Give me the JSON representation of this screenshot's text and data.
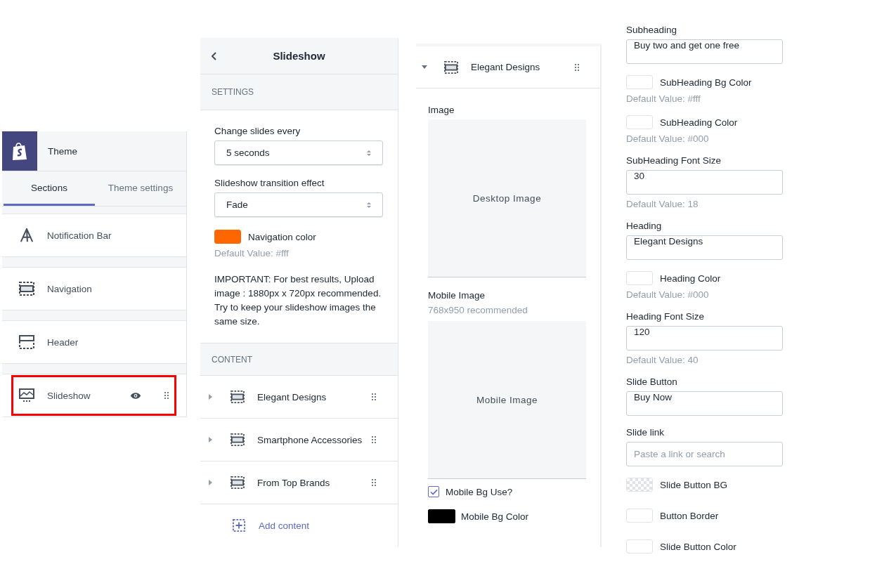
{
  "theme_panel": {
    "title": "Theme",
    "tabs": [
      {
        "label": "Sections",
        "selected": true
      },
      {
        "label": "Theme settings",
        "selected": false
      }
    ],
    "sections": [
      {
        "kind": "text",
        "label": "Notification Bar",
        "highlighted": false
      },
      {
        "kind": "navigation",
        "label": "Navigation",
        "highlighted": false
      },
      {
        "kind": "header",
        "label": "Header",
        "highlighted": false
      },
      {
        "kind": "slideshow",
        "label": "Slideshow",
        "highlighted": true
      }
    ]
  },
  "slideshow_panel": {
    "title": "Slideshow",
    "settings_heading": "SETTINGS",
    "settings": [
      {
        "kind": "select",
        "label": "Change slides every",
        "value": "5 seconds"
      },
      {
        "kind": "select",
        "label": "Slideshow transition effect",
        "value": "Fade"
      },
      {
        "kind": "color",
        "label": "Navigation color",
        "color": "#ff6600",
        "hint": "Default Value: #fff"
      },
      {
        "kind": "note",
        "text": "IMPORTANT: For best results, Upload image : 1880px x 720px recommended. Try to keep your slideshow images the same size."
      }
    ],
    "content_heading": "CONTENT",
    "blocks": [
      {
        "label": "Elegant Designs"
      },
      {
        "label": "Smartphone Accessories"
      },
      {
        "label": "From Top Brands"
      }
    ],
    "add_label": "Add content"
  },
  "block_panel": {
    "title": "Elegant Designs",
    "expanded": true,
    "fields": [
      {
        "kind": "image",
        "label": "Image",
        "placeholder": "Desktop Image"
      },
      {
        "kind": "image",
        "label": "Mobile Image",
        "hint": "768x950 recommended",
        "placeholder": "Mobile Image"
      },
      {
        "kind": "checkbox",
        "label": "Mobile Bg Use?",
        "checked": true
      },
      {
        "kind": "color",
        "label": "Mobile Bg Color",
        "color": "#000000"
      }
    ]
  },
  "block_settings": [
    {
      "kind": "text",
      "label": "Subheading",
      "value": "Buy two and get one free"
    },
    {
      "kind": "color",
      "label": "SubHeading Bg Color",
      "color": "#ffffff",
      "hint": "Default Value: #fff"
    },
    {
      "kind": "color",
      "label": "SubHeading Color",
      "color": "#ffffff",
      "hint": "Default Value: #000"
    },
    {
      "kind": "text",
      "label": "SubHeading Font Size",
      "value": "30",
      "hint": "Default Value: 18"
    },
    {
      "kind": "text",
      "label": "Heading",
      "value": "Elegant Designs"
    },
    {
      "kind": "color",
      "label": "Heading Color",
      "color": "#ffffff",
      "hint": "Default Value: #000"
    },
    {
      "kind": "text",
      "label": "Heading Font Size",
      "value": "120",
      "hint": "Default Value: 40"
    },
    {
      "kind": "text",
      "label": "Slide Button",
      "value": "Buy Now"
    },
    {
      "kind": "text",
      "label": "Slide link",
      "placeholder": "Paste a link or search"
    },
    {
      "kind": "clear_color",
      "label": "Slide Button BG"
    },
    {
      "kind": "color",
      "label": "Button Border",
      "color": "#ffffff"
    },
    {
      "kind": "color",
      "label": "Slide Button Color",
      "color": "#ffffff"
    }
  ]
}
